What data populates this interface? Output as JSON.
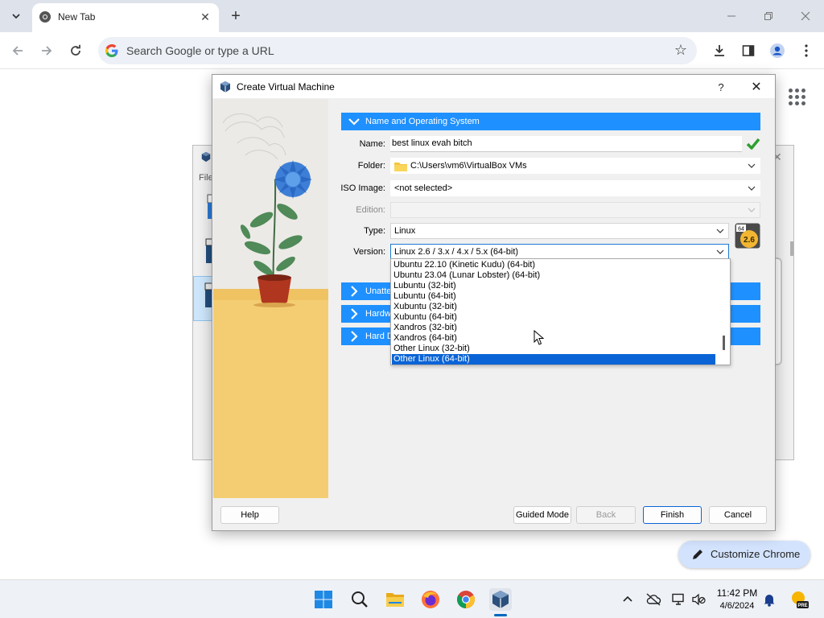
{
  "browser": {
    "tab_title": "New Tab",
    "omnibox_placeholder": "Search Google or type a URL",
    "customize_label": "Customize Chrome"
  },
  "dialog": {
    "title": "Create Virtual Machine",
    "help_glyph": "?",
    "sections": [
      {
        "label": "Name and Operating System",
        "expanded": true
      },
      {
        "label": "Unattended Install",
        "expanded": false
      },
      {
        "label": "Hardware",
        "expanded": false
      },
      {
        "label": "Hard Disk",
        "expanded": false
      }
    ],
    "fields": {
      "name_label": "Name:",
      "name_value": "best linux evah bitch",
      "folder_label": "Folder:",
      "folder_value": "C:\\Users\\vm6\\VirtualBox VMs",
      "iso_label": "ISO Image:",
      "iso_value": "<not selected>",
      "edition_label": "Edition:",
      "type_label": "Type:",
      "type_value": "Linux",
      "version_label": "Version:",
      "version_value": "Linux 2.6 / 3.x / 4.x / 5.x (64-bit)"
    },
    "os_badge": {
      "arch": "64",
      "version": "2.6"
    },
    "version_options": [
      "Ubuntu 22.10 (Kinetic Kudu) (64-bit)",
      "Ubuntu 23.04 (Lunar Lobster) (64-bit)",
      "Lubuntu (32-bit)",
      "Lubuntu (64-bit)",
      "Xubuntu (32-bit)",
      "Xubuntu (64-bit)",
      "Xandros (32-bit)",
      "Xandros (64-bit)",
      "Other Linux (32-bit)",
      "Other Linux (64-bit)"
    ],
    "highlighted_option_index": 9,
    "buttons": {
      "help": "Help",
      "guided_mode": "Guided Mode",
      "back": "Back",
      "finish": "Finish",
      "cancel": "Cancel"
    }
  },
  "background_window": {
    "file_menu_fragment": "File"
  },
  "taskbar": {
    "time": "11:42 PM",
    "date": "4/6/2024",
    "weather_badge": "PRE"
  },
  "colors": {
    "section_blue": "#1e90ff",
    "selection_blue": "#0a64d6",
    "chrome_tabbar": "#dee3eb",
    "customize_bg": "#d3e3fd",
    "art_yellow": "#f4cd72"
  }
}
